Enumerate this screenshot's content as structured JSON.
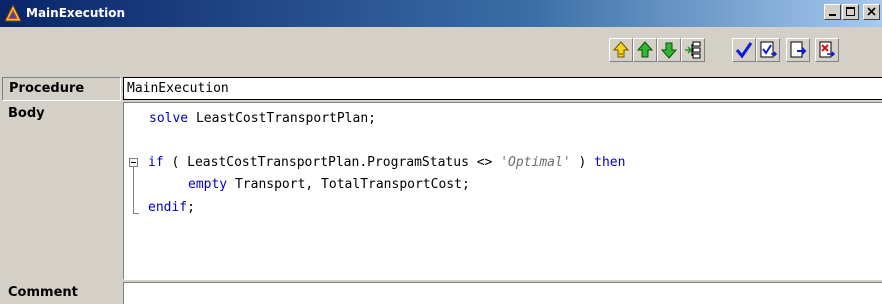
{
  "window": {
    "title": "MainExecution"
  },
  "toolbar": {
    "buttons": [
      "move-up-to-parent",
      "move-up",
      "move-down",
      "expand-tree",
      "check",
      "check-all",
      "export",
      "delete-export"
    ]
  },
  "form": {
    "procedure_label": "Procedure",
    "procedure_value": "MainExecution",
    "body_label": "Body",
    "comment_label": "Comment",
    "comment_value": ""
  },
  "code": {
    "line1_kw": "solve",
    "line1_rest": " LeastCostTransportPlan;",
    "line2_kw_if": "if",
    "line2_mid": " ( LeastCostTransportPlan.ProgramStatus <> ",
    "line2_str": "'Optimal'",
    "line2_close": " ) ",
    "line2_kw_then": "then",
    "line3_kw": "empty",
    "line3_rest": " Transport, TotalTransportCost;",
    "line4_kw": "endif",
    "line4_rest": ";"
  },
  "colors": {
    "keyword": "#0000c8",
    "string": "#6e6e6e",
    "title_bar": "#0a246a"
  }
}
